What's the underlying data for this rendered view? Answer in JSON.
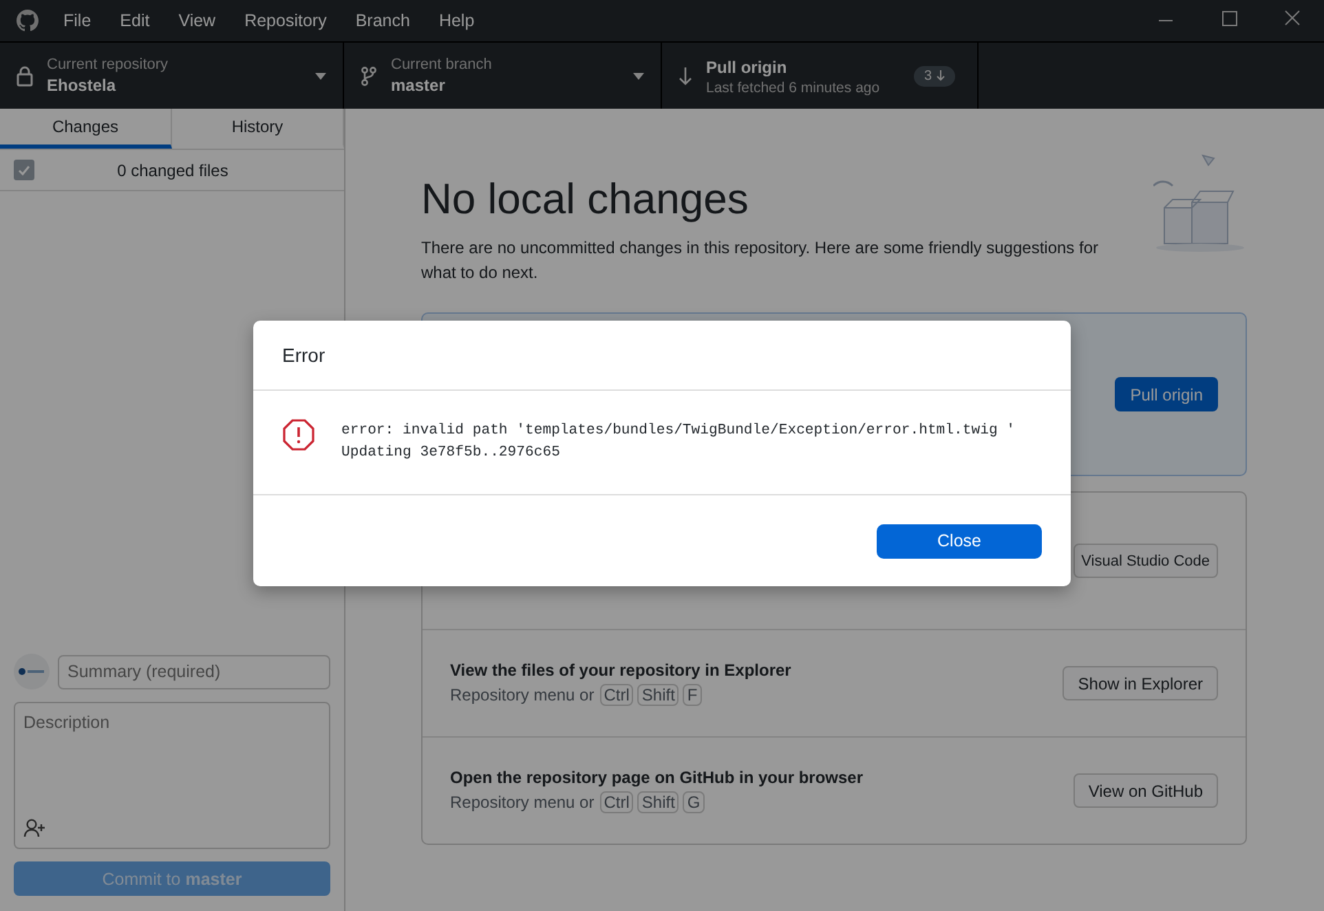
{
  "menu_bar": {
    "items": [
      "File",
      "Edit",
      "View",
      "Repository",
      "Branch",
      "Help"
    ]
  },
  "toolbar": {
    "repository": {
      "label": "Current repository",
      "value": "Ehostela"
    },
    "branch": {
      "label": "Current branch",
      "value": "master"
    },
    "fetch": {
      "title": "Pull origin",
      "subtitle": "Last fetched 6 minutes ago",
      "badge": "3"
    }
  },
  "sidebar": {
    "tabs": [
      {
        "label": "Changes",
        "selected": true
      },
      {
        "label": "History",
        "selected": false
      }
    ],
    "changes": {
      "label": "0 changed files",
      "checked": true
    },
    "commit": {
      "summary_placeholder": "Summary (required)",
      "description_placeholder": "Description",
      "button": "Commit to **master**",
      "disabled": true
    }
  },
  "main": {
    "title": "No local changes",
    "description": "There are no uncommitted changes in this repository. Here are some friendly suggestions for what to do next.",
    "primary_suggestion": {
      "button": "Pull origin"
    },
    "suggestions": [
      {
        "button": "Visual Studio Code"
      },
      {
        "title": "View the files of your repository in Explorer",
        "hint": "Repository menu or",
        "keys": [
          "Ctrl",
          "Shift",
          "F"
        ],
        "button": "Show in Explorer"
      },
      {
        "title": "Open the repository page on GitHub in your browser",
        "hint": "Repository menu or",
        "keys": [
          "Ctrl",
          "Shift",
          "G"
        ],
        "button": "View on GitHub"
      }
    ]
  },
  "dialog": {
    "title": "Error",
    "lines": [
      "error: invalid path 'templates/bundles/TwigBundle/Exception/error.html.twig '",
      "Updating 3e78f5b..2976c65"
    ],
    "button": "Close"
  }
}
